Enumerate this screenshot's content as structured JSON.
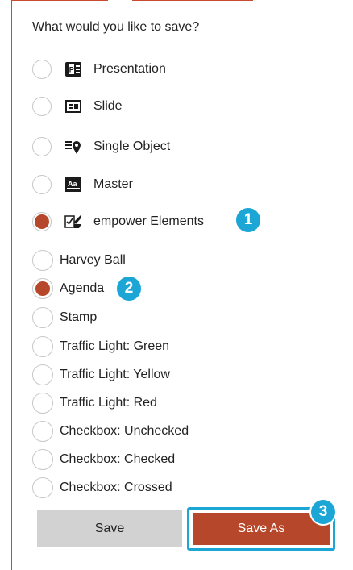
{
  "dialog": {
    "title": "What would you like to save?"
  },
  "main_options": [
    {
      "label": "Presentation",
      "icon": "presentation-icon",
      "checked": false
    },
    {
      "label": "Slide",
      "icon": "slide-icon",
      "checked": false
    },
    {
      "label": "Single Object",
      "icon": "single-object-icon",
      "checked": false
    },
    {
      "label": "Master",
      "icon": "master-icon",
      "checked": false
    },
    {
      "label": "empower Elements",
      "icon": "empower-elements-icon",
      "checked": true
    }
  ],
  "sub_options": [
    {
      "label": "Harvey Ball",
      "checked": false
    },
    {
      "label": "Agenda",
      "checked": true
    },
    {
      "label": "Stamp",
      "checked": false
    },
    {
      "label": "Traffic Light: Green",
      "checked": false
    },
    {
      "label": "Traffic Light: Yellow",
      "checked": false
    },
    {
      "label": "Traffic Light: Red",
      "checked": false
    },
    {
      "label": "Checkbox: Unchecked",
      "checked": false
    },
    {
      "label": "Checkbox: Checked",
      "checked": false
    },
    {
      "label": "Checkbox: Crossed",
      "checked": false
    }
  ],
  "buttons": {
    "save": "Save",
    "save_as": "Save As"
  },
  "badges": {
    "one": "1",
    "two": "2",
    "three": "3"
  },
  "colors": {
    "accent": "#b7472a",
    "callout": "#1ba6d6",
    "button_gray": "#d2d2d2"
  }
}
